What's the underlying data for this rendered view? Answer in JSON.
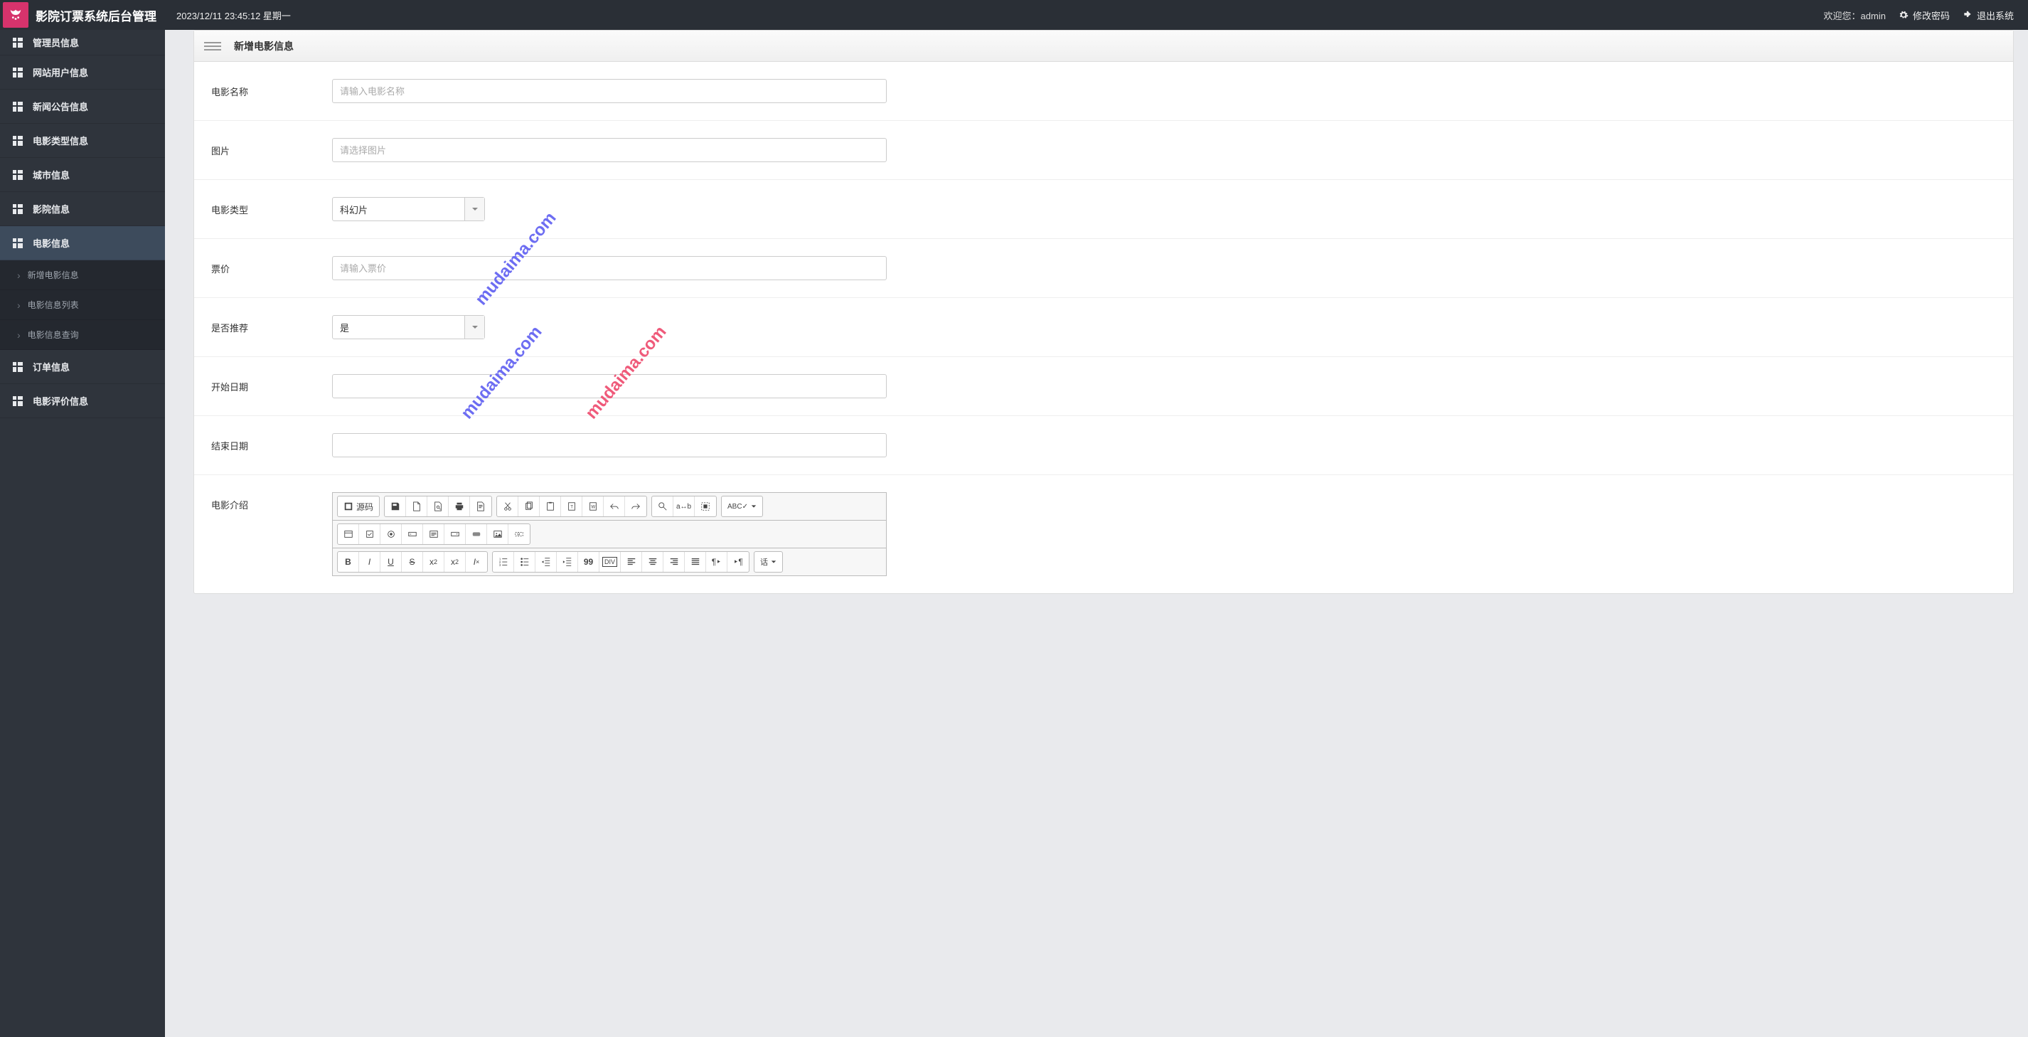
{
  "header": {
    "app_title": "影院订票系统后台管理",
    "datetime": "2023/12/11 23:45:12 星期一",
    "welcome_prefix": "欢迎您：",
    "username": "admin",
    "change_pwd": "修改密码",
    "logout": "退出系统"
  },
  "sidebar": {
    "items": [
      {
        "label": "管理员信息",
        "name": "admin-info"
      },
      {
        "label": "网站用户信息",
        "name": "site-user-info"
      },
      {
        "label": "新闻公告信息",
        "name": "news-info"
      },
      {
        "label": "电影类型信息",
        "name": "movie-type-info"
      },
      {
        "label": "城市信息",
        "name": "city-info"
      },
      {
        "label": "影院信息",
        "name": "cinema-info"
      },
      {
        "label": "电影信息",
        "name": "movie-info",
        "active": true
      },
      {
        "label": "订单信息",
        "name": "order-info"
      },
      {
        "label": "电影评价信息",
        "name": "review-info"
      }
    ],
    "sub_items": [
      {
        "label": "新增电影信息",
        "name": "add-movie"
      },
      {
        "label": "电影信息列表",
        "name": "movie-list"
      },
      {
        "label": "电影信息查询",
        "name": "movie-search"
      }
    ]
  },
  "panel": {
    "title": "新增电影信息"
  },
  "form": {
    "movie_name": {
      "label": "电影名称",
      "placeholder": "请输入电影名称",
      "value": ""
    },
    "image": {
      "label": "图片",
      "placeholder": "请选择图片",
      "value": ""
    },
    "movie_type": {
      "label": "电影类型",
      "value": "科幻片"
    },
    "price": {
      "label": "票价",
      "placeholder": "请输入票价",
      "value": ""
    },
    "recommend": {
      "label": "是否推荐",
      "value": "是"
    },
    "start_date": {
      "label": "开始日期",
      "value": ""
    },
    "end_date": {
      "label": "结束日期",
      "value": ""
    },
    "intro": {
      "label": "电影介绍"
    }
  },
  "editor": {
    "source_label": "源码"
  },
  "watermark": "mudaima.com"
}
